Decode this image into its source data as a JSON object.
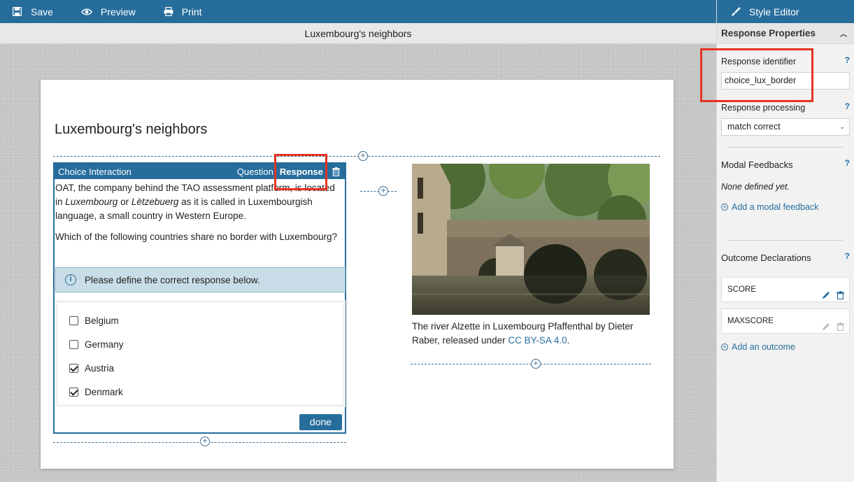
{
  "toolbar": {
    "save_label": "Save",
    "preview_label": "Preview",
    "print_label": "Print"
  },
  "title_bar": {
    "title": "Luxembourg's neighbors"
  },
  "item": {
    "title": "Luxembourg's neighbors",
    "choice_interaction": {
      "header_label": "Choice Interaction",
      "tab_question": "Question",
      "tab_response": "Response",
      "prompt_part1": "OAT, the company behind the TAO assessment platform, is located in ",
      "prompt_em1": "Luxembourg",
      "prompt_part2": " or ",
      "prompt_em2": "Lëtzebuerg",
      "prompt_part3": " as it is called in Luxembourgish language, a small country in Western Europe.",
      "question": "Which of the following countries share no border with Luxembourg?",
      "info_text": "Please define the correct response below.",
      "choices": [
        {
          "label": "Belgium",
          "checked": false
        },
        {
          "label": "Germany",
          "checked": false
        },
        {
          "label": "Austria",
          "checked": true
        },
        {
          "label": "Denmark",
          "checked": true
        }
      ],
      "done_label": "done"
    },
    "image": {
      "caption_text": "The river Alzette in Luxembourg Pfaffenthal by Dieter Raber, released under ",
      "caption_link": "CC BY-SA 4.0",
      "caption_end": "."
    }
  },
  "style_editor": {
    "header_label": "Style Editor",
    "section_title": "Response Properties",
    "response_identifier_label": "Response identifier",
    "response_identifier_value": "choice_lux_border",
    "response_processing_label": "Response processing",
    "response_processing_value": "match correct",
    "modal_feedbacks_label": "Modal Feedbacks",
    "modal_feedbacks_empty": "None defined yet.",
    "add_modal_feedback": "Add a modal feedback",
    "outcome_declarations_label": "Outcome Declarations",
    "outcomes": [
      "SCORE",
      "MAXSCORE"
    ],
    "add_outcome": "Add an outcome",
    "help_mark": "?"
  },
  "colors": {
    "toolbar_bg": "#266d9c",
    "highlight": "#e53323"
  }
}
